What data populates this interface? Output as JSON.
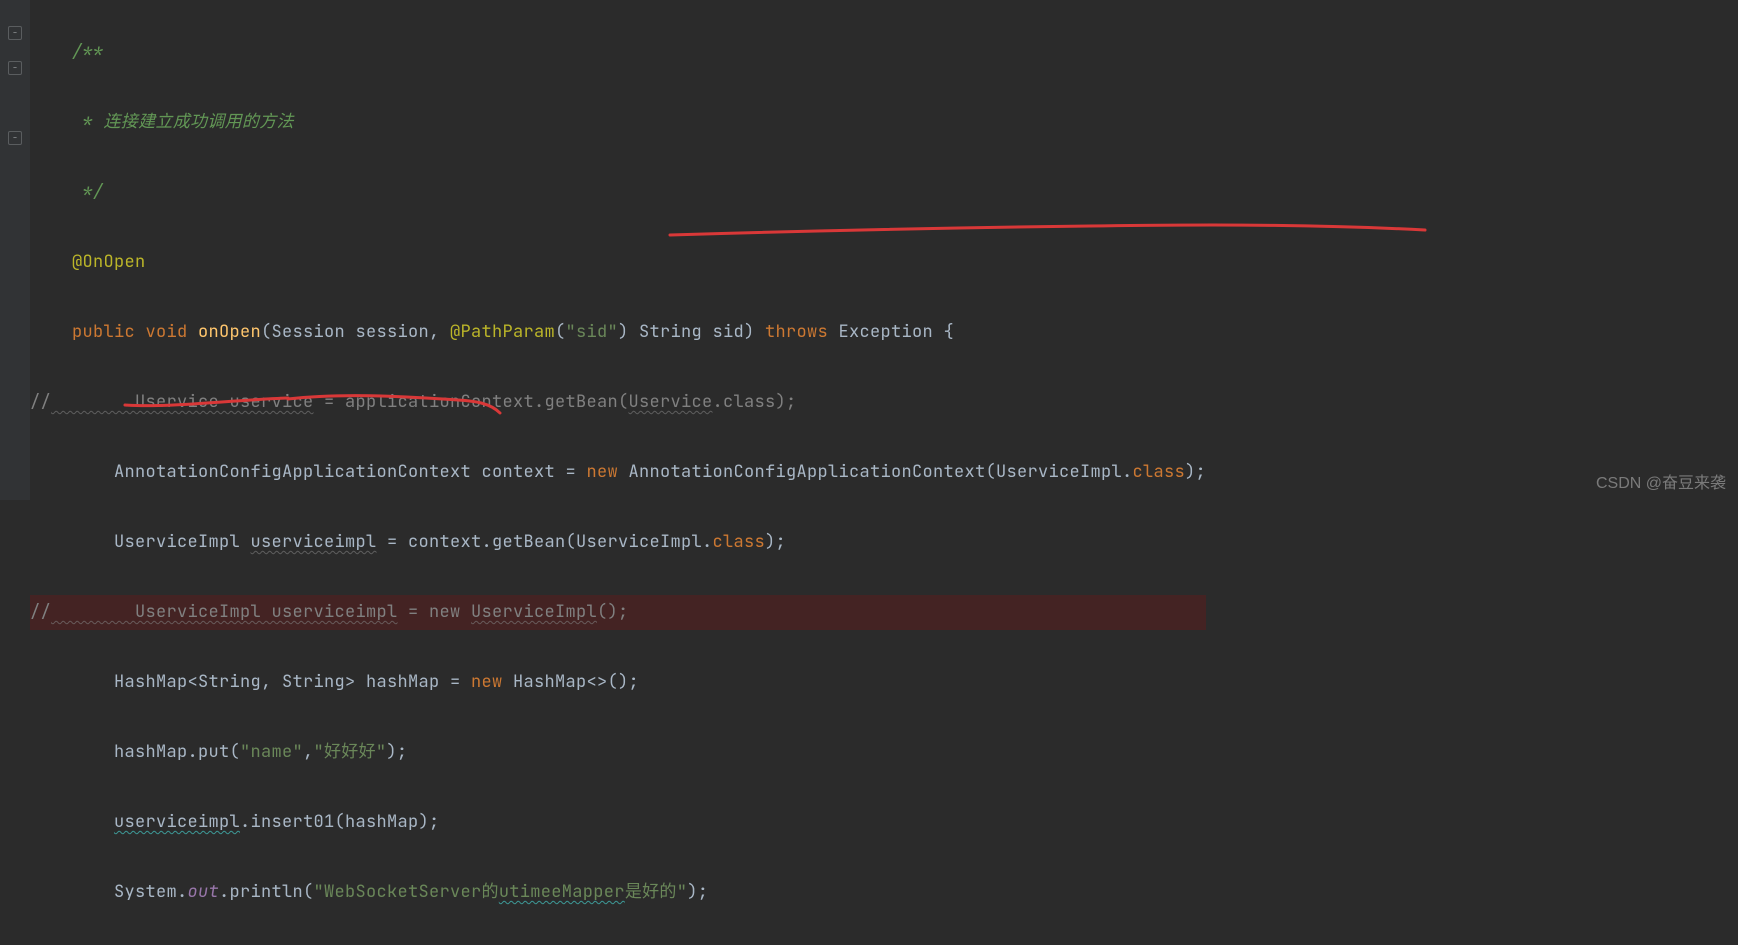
{
  "code": {
    "l0_a": "    /**",
    "l1_a": "     * ",
    "l1_b": "连接建立成功调用的方法",
    "l2_a": "     */",
    "l3_a": "    @OnOpen",
    "l4_a": "    public",
    "l4_b": " void",
    "l4_c": " onOpen",
    "l4_d": "(Session session, ",
    "l4_e": "@PathParam",
    "l4_f": "(",
    "l4_g": "\"sid\"",
    "l4_h": ") String sid) ",
    "l4_i": "throws",
    "l4_j": " Exception {",
    "l5_a": "//",
    "l5_b": "        Uservice",
    "l5_c": " uservice",
    "l5_d": " = applicationContext.getBean(",
    "l5_e": "Uservice",
    "l5_f": ".class);",
    "l6_a": "        AnnotationConfigApplicationContext context = ",
    "l6_b": "new",
    "l6_c": " AnnotationConfigApplicationContext(UserviceImpl.",
    "l6_d": "class",
    "l6_e": ");",
    "l7_a": "        UserviceImpl ",
    "l7_b": "userviceimpl",
    "l7_c": " = context.getBean(UserviceImpl.",
    "l7_d": "class",
    "l7_e": ");",
    "l8_a": "//",
    "l8_b": "        UserviceImpl",
    "l8_c": " userviceimpl",
    "l8_d": " = new ",
    "l8_e": "UserviceImpl",
    "l8_f": "();",
    "l9_a": "        HashMap<String, String> hashMap = ",
    "l9_b": "new",
    "l9_c": " HashMap<>();",
    "l10_a": "        hashMap.put(",
    "l10_b": "\"name\"",
    "l10_c": ",",
    "l10_d": "\"好好好\"",
    "l10_e": ");",
    "l11_a": "        ",
    "l11_b": "userviceimpl",
    "l11_c": ".insert01(hashMap);",
    "l12_a": "        System.",
    "l12_b": "out",
    "l12_c": ".println(",
    "l12_d": "\"WebSocketServer的",
    "l12_e": "utimeeMapper",
    "l12_f": "是好的\"",
    "l12_g": ");"
  },
  "watermark": "CSDN @奋豆来袭"
}
